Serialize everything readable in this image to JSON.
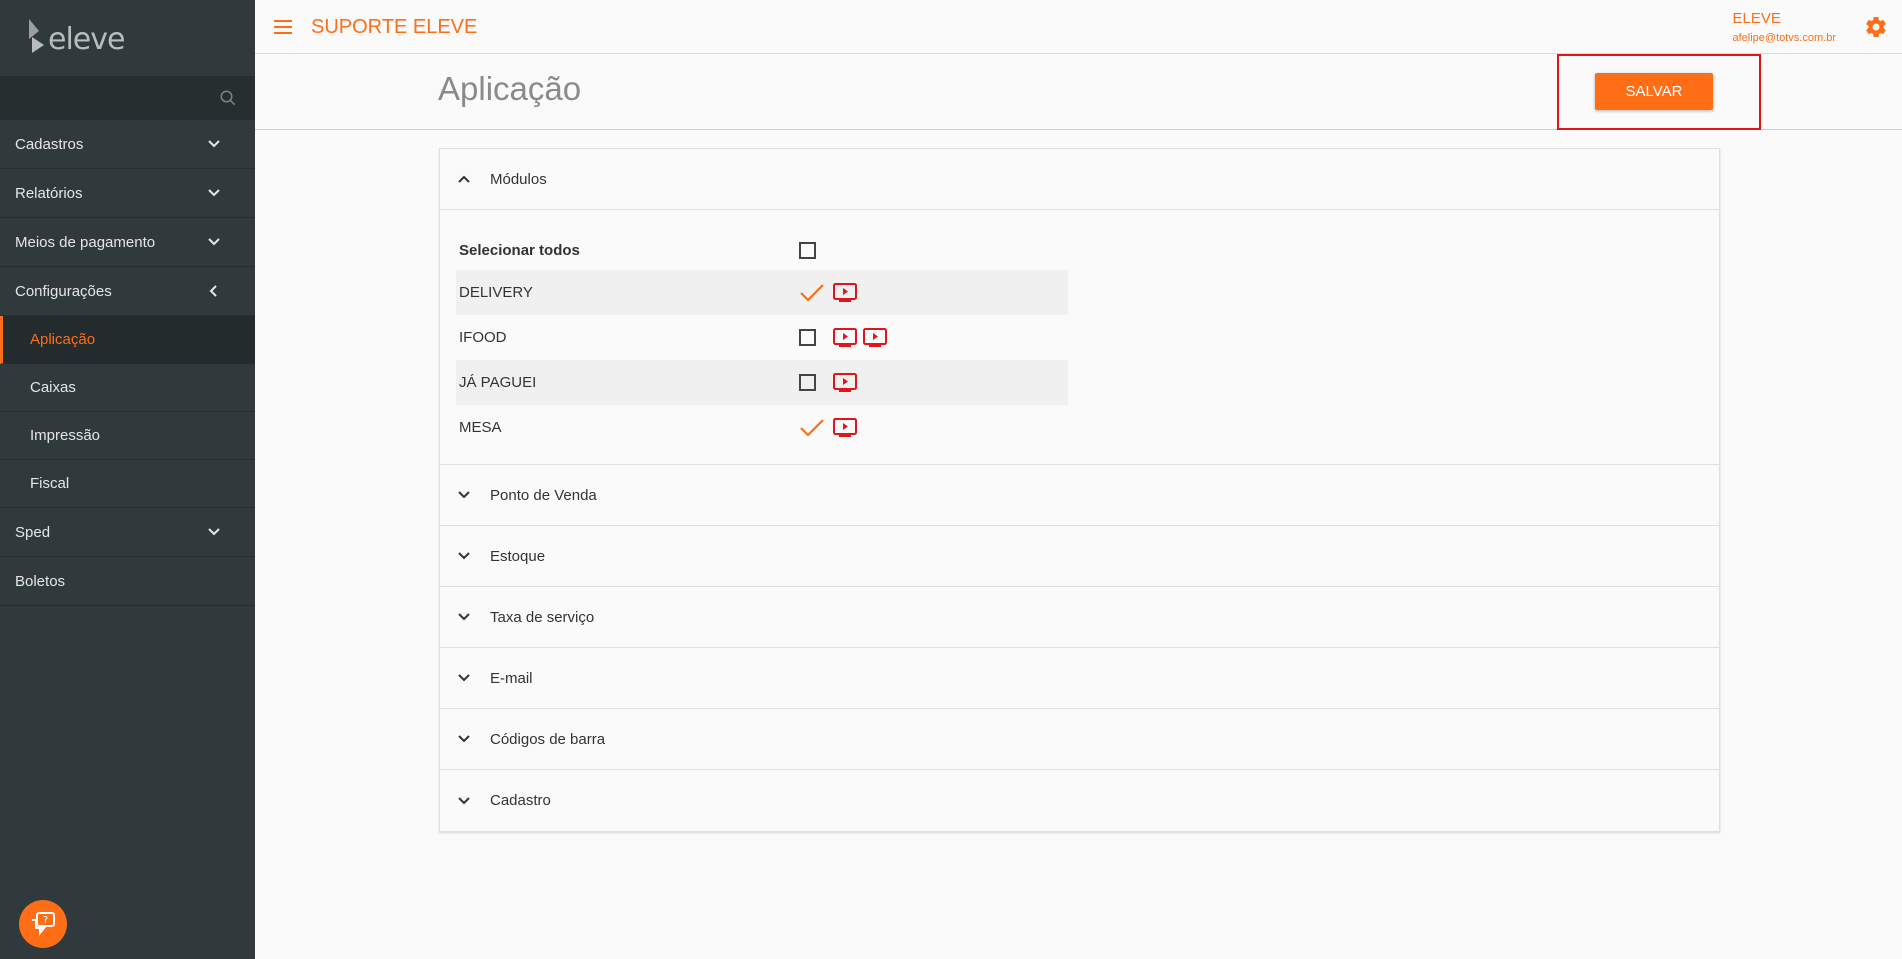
{
  "brand": {
    "logo_text": "eleve",
    "accent": "#ff6d17"
  },
  "sidebar": {
    "search_icon": "search-icon",
    "items": [
      {
        "label": "Cadastros",
        "expandable": true
      },
      {
        "label": "Relatórios",
        "expandable": true
      },
      {
        "label": "Meios de pagamento",
        "expandable": true
      },
      {
        "label": "Configurações",
        "expanded": true
      },
      {
        "label": "Aplicação",
        "sub": true,
        "active": true
      },
      {
        "label": "Caixas",
        "sub": true
      },
      {
        "label": "Impressão",
        "sub": true
      },
      {
        "label": "Fiscal",
        "sub": true
      },
      {
        "label": "Sped",
        "expandable": true
      },
      {
        "label": "Boletos"
      }
    ]
  },
  "topbar": {
    "title": "SUPORTE ELEVE",
    "user_name": "ELEVE",
    "user_email": "afelipe@totvs.com.br"
  },
  "page": {
    "title": "Aplicação",
    "save_label": "SALVAR"
  },
  "modules": {
    "title": "Módulos",
    "select_all": "Selecionar todos",
    "items": [
      {
        "label": "DELIVERY",
        "checked": true,
        "videos": 1
      },
      {
        "label": "IFOOD",
        "checked": false,
        "videos": 2
      },
      {
        "label": "JÁ PAGUEI",
        "checked": false,
        "videos": 1
      },
      {
        "label": "MESA",
        "checked": true,
        "videos": 1
      }
    ]
  },
  "sections": [
    "Ponto de Venda",
    "Estoque",
    "Taxa de serviço",
    "E-mail",
    "Códigos de barra",
    "Cadastro"
  ]
}
